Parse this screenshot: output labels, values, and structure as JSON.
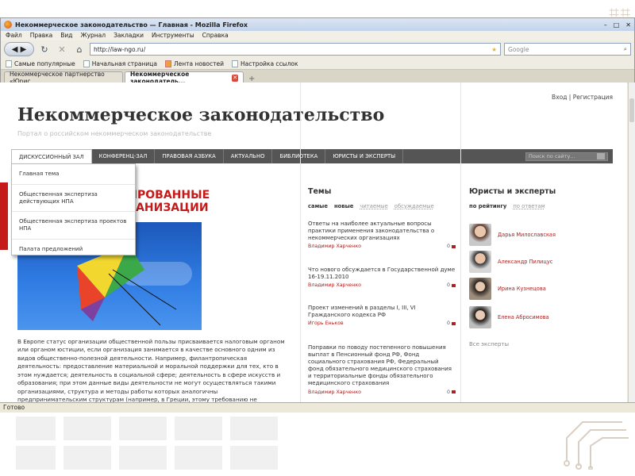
{
  "window": {
    "title": "Некоммерческое законодательство — Главная - Mozilla Firefox"
  },
  "menu": [
    "Файл",
    "Правка",
    "Вид",
    "Журнал",
    "Закладки",
    "Инструменты",
    "Справка"
  ],
  "url": "http://law-ngo.ru/",
  "search_placeholder": "Google",
  "bookmarks": [
    "Самые популярные",
    "Начальная страница",
    "Лента новостей",
    "Настройка ссылок"
  ],
  "tabs": [
    {
      "label": "Некоммерческое партнерство «Юрис..."
    },
    {
      "label": "Некоммерческое законодатель..."
    }
  ],
  "status": "Готово",
  "site": {
    "login": "Вход",
    "register": "Регистрация",
    "title": "Некоммерческое законодательство",
    "subtitle": "Портал о российском некоммерческом законодательстве",
    "nav": [
      "ДИСКУССИОННЫЙ ЗАЛ",
      "КОНФЕРЕНЦ-ЗАЛ",
      "ПРАВОВАЯ АЗБУКА",
      "АКТУАЛЬНО",
      "БИБЛИОТЕКА",
      "ЮРИСТЫ И ЭКСПЕРТЫ"
    ],
    "search_placeholder": "Поиск по сайту...",
    "dropdown": [
      "Главная тема",
      "Общественная экспертиза действующих НПА",
      "Общественная экспертиза проектов НПА",
      "Палата предложений"
    ],
    "hero_line1": "НТИРОВАННЫЕ",
    "hero_line2": "ОРГАНИЗАЦИИ",
    "body": "В Европе статус организации общественной пользы присваивается налоговым органом или органом юстиции, если организация занимается в качестве основного одним из видов общественно-полезной деятельности. Например, филантропическая деятельность: предоставление материальной и моральной поддержки для тех, кто в этом нуждается; деятельность в социальной сфере; деятельность в сфере искусств и образования; при этом данные виды деятельности не могут осуществляться такими организациями, структура и методы работы которых аналогичны предпринимательским структурам (например, в Греции, этому требованию не удовлетворяют частные школы и курсу по изучению иностранных языков).",
    "topics_heading": "Темы",
    "topic_filters": [
      "самые",
      "новые",
      "читаемые",
      "обсуждаемые"
    ],
    "topics": [
      {
        "title": "Ответы на наиболее актуальные вопросы практики применения законодательства о некоммерческих организациях",
        "author": "Владимир Харченко",
        "count": "0"
      },
      {
        "title": "Что нового обсуждается в Государственной думе 16-19.11.2010",
        "author": "Владимир Харченко",
        "count": "0"
      },
      {
        "title": "Проект изменений в разделы I, III, VI Гражданского кодекса РФ",
        "author": "Игорь Еньков",
        "count": "0"
      },
      {
        "title": "Поправки по поводу постепенного повышения выплат в Пенсионный фонд РФ, Фонд социального страхования РФ, Федеральный фонд обязательного медицинского страхования и территориальные фонды обязательного медицинского страхования",
        "author": "Владимир Харченко",
        "count": "0"
      }
    ],
    "experts_heading": "Юристы и эксперты",
    "expert_filters": [
      "по рейтингу",
      "по ответам"
    ],
    "experts": [
      "Дарья Милославская",
      "Александр Пилицус",
      "Ирина Кузнецова",
      "Елена Абросимова"
    ],
    "all_experts": "Все эксперты"
  }
}
